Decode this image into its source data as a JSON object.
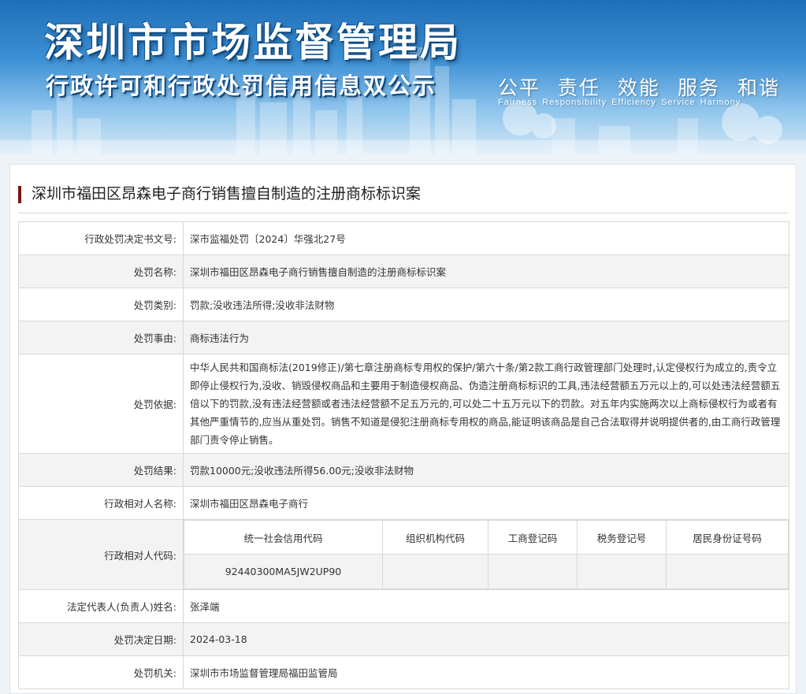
{
  "banner": {
    "title": "深圳市市场监督管理局",
    "subtitle": "行政许可和行政处罚信用信息双公示",
    "motto_cn": [
      "公平",
      "责任",
      "效能",
      "服务",
      "和谐"
    ],
    "motto_en": [
      "Fairness",
      "Responsibility",
      "Efficiency",
      "Service",
      "Harmony"
    ]
  },
  "case_title": "深圳市福田区昂森电子商行销售擅自制造的注册商标标识案",
  "fields": {
    "doc_no": {
      "label": "行政处罚决定书文号:",
      "value": "深市监福处罚〔2024〕华强北27号"
    },
    "name": {
      "label": "处罚名称:",
      "value": "深圳市福田区昂森电子商行销售擅自制造的注册商标标识案"
    },
    "category": {
      "label": "处罚类别:",
      "value": "罚款;没收违法所得;没收非法财物"
    },
    "reason": {
      "label": "处罚事由:",
      "value": "商标违法行为"
    },
    "basis": {
      "label": "处罚依据:",
      "value": "中华人民共和国商标法(2019修正)/第七章注册商标专用权的保护/第六十条/第2款工商行政管理部门处理时,认定侵权行为成立的,责令立即停止侵权行为,没收、销毁侵权商品和主要用于制造侵权商品、伪造注册商标标识的工具,违法经营额五万元以上的,可以处违法经营额五倍以下的罚款,没有违法经营额或者违法经营额不足五万元的,可以处二十五万元以下的罚款。对五年内实施两次以上商标侵权行为或者有其他严重情节的,应当从重处罚。销售不知道是侵犯注册商标专用权的商品,能证明该商品是自己合法取得并说明提供者的,由工商行政管理部门责令停止销售。"
    },
    "result": {
      "label": "处罚结果:",
      "value": "罚款10000元;没收违法所得56.00元;没收非法财物"
    },
    "party_name": {
      "label": "行政相对人名称:",
      "value": "深圳市福田区昂森电子商行"
    },
    "party_code": {
      "label": "行政相对人代码:",
      "columns": [
        "统一社会信用代码",
        "组织机构代码",
        "工商登记码",
        "税务登记号",
        "居民身份证号码"
      ],
      "values": [
        "92440300MA5JW2UP90",
        "",
        "",
        "",
        ""
      ]
    },
    "legal_rep": {
      "label": "法定代表人(负责人)姓名:",
      "value": "张泽端"
    },
    "date": {
      "label": "处罚决定日期:",
      "value": "2024-03-18"
    },
    "authority": {
      "label": "处罚机关:",
      "value": "深圳市市场监督管理局福田监管局"
    }
  }
}
